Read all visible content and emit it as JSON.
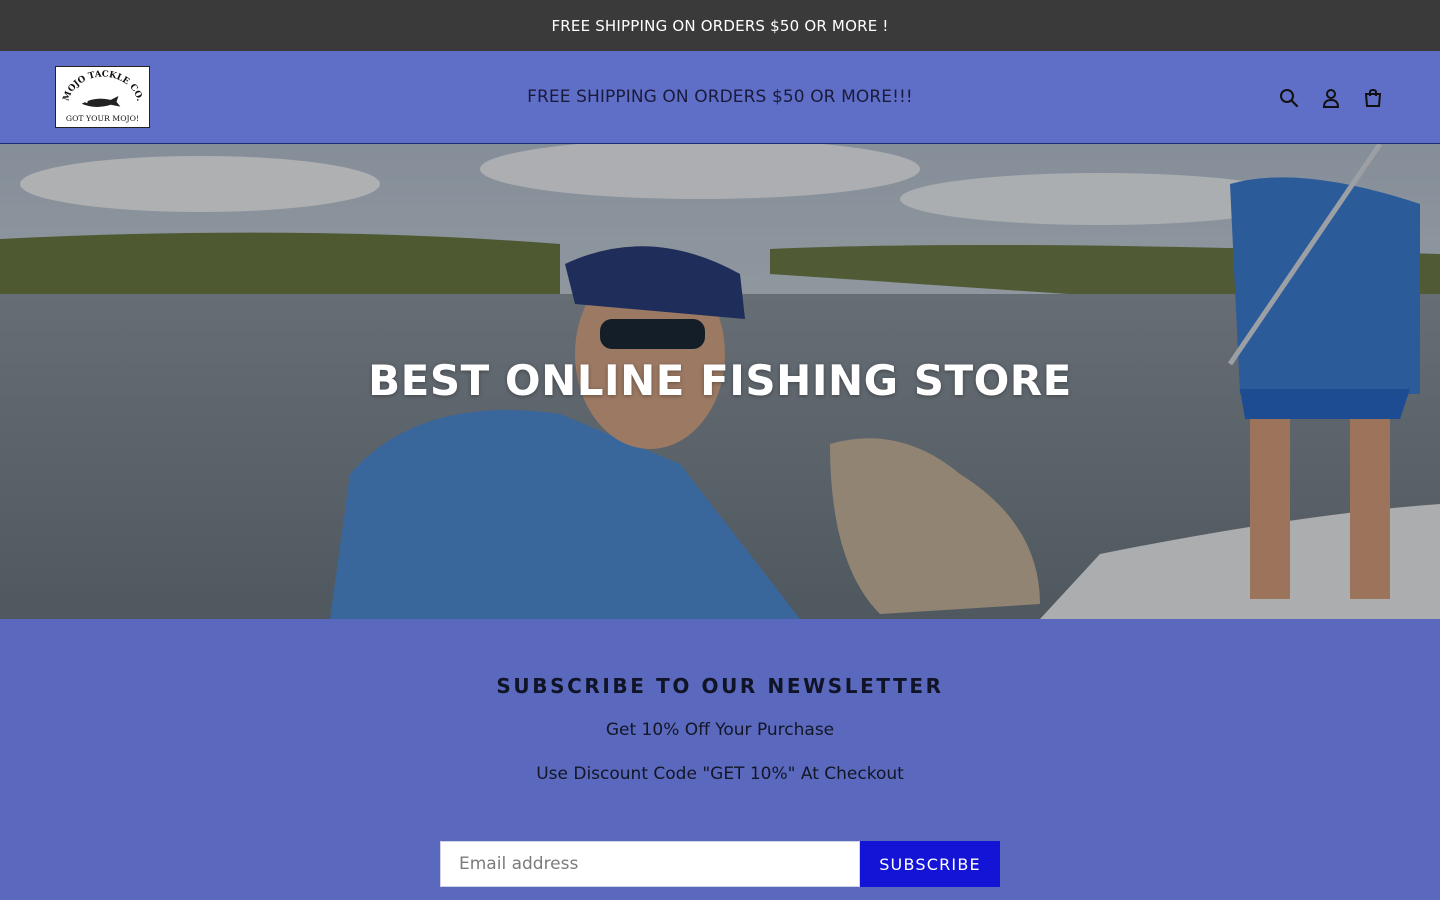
{
  "announcement": {
    "text": "FREE SHIPPING ON ORDERS $50 OR MORE !"
  },
  "header": {
    "logo": {
      "top_text": "MOJO TACKLE CO.",
      "bottom_text": "GOT YOUR MOJO!"
    },
    "message": "FREE SHIPPING ON ORDERS $50 OR MORE!!!",
    "icons": [
      "search-icon",
      "account-icon",
      "cart-icon"
    ]
  },
  "hero": {
    "title": "BEST ONLINE FISHING STORE"
  },
  "newsletter": {
    "title": "SUBSCRIBE TO OUR NEWSLETTER",
    "subtitle": "Get 10% Off Your Purchase",
    "code_text": "Use Discount Code \"GET 10%\" At Checkout",
    "email_placeholder": "Email address",
    "button_label": "SUBSCRIBE"
  },
  "colors": {
    "announcement_bg": "#3a3a3a",
    "header_bg": "#5f6fc8",
    "newsletter_bg": "#5a69bd",
    "button_bg": "#1414d6"
  }
}
